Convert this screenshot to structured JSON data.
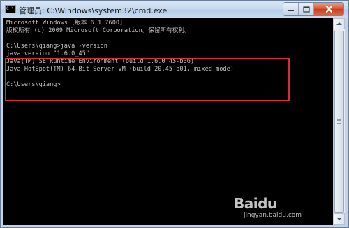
{
  "window": {
    "title": "管理员: C:\\Windows\\system32\\cmd.exe",
    "app_icon_text": "C:\\",
    "controls": [
      "minimize",
      "maximize",
      "close"
    ]
  },
  "console": {
    "lines": [
      "Microsoft Windows [版本 6.1.7600]",
      "版权所有 (c) 2009 Microsoft Corporation。保留所有权利。",
      "",
      "C:\\Users\\qiang>java -version",
      "java version \"1.6.0_45\"",
      "Java(TM) SE Runtime Environment (build 1.6.0_45-b06)",
      "Java HotSpot(TM) 64-Bit Server VM (build 20.45-b01, mixed mode)",
      "",
      "C:\\Users\\qiang>"
    ]
  },
  "watermark": {
    "logo_text": "Baidu",
    "url": "jingyan.baidu.com"
  },
  "colors": {
    "console_bg": "#000000",
    "console_text": "#c0c0c0",
    "highlight_border": "#e0283a",
    "titlebar": "#c5d8ef"
  }
}
